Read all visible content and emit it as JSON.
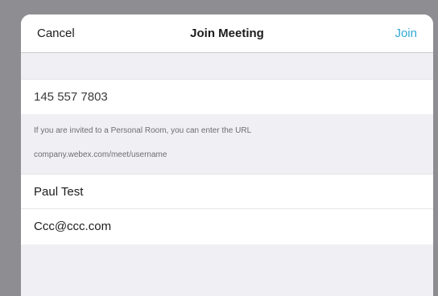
{
  "navbar": {
    "cancel_label": "Cancel",
    "title": "Join Meeting",
    "join_label": "Join"
  },
  "form": {
    "meeting_number": "145 557 7803",
    "hint_line1": "If you are invited to a Personal Room, you can enter the URL",
    "hint_line2": "company.webex.com/meet/username",
    "name_value": "Paul Test",
    "email_value": "Ccc@ccc.com"
  },
  "colors": {
    "accent": "#2fa8d3",
    "backdrop": "#8e8e92",
    "grouped_background": "#efeff4"
  }
}
